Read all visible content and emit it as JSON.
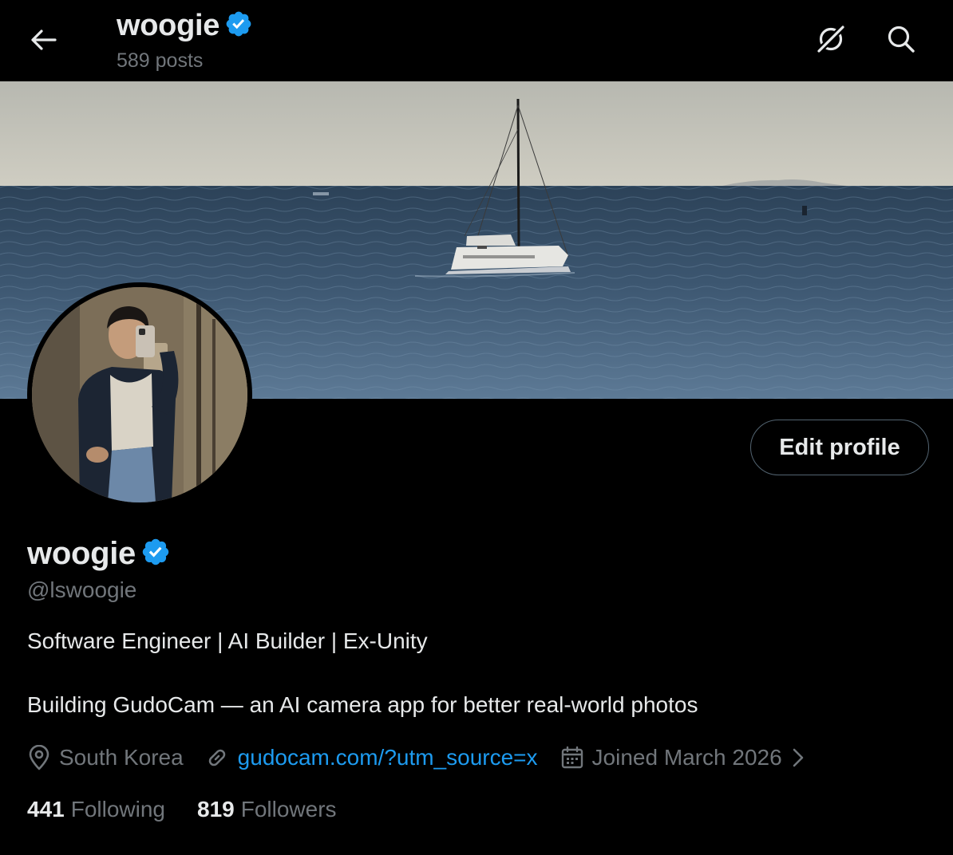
{
  "header": {
    "name": "woogie",
    "posts_count": "589 posts",
    "back_icon": "arrow-left-icon",
    "grok_icon": "grok-icon",
    "search_icon": "search-icon"
  },
  "profile": {
    "display_name": "woogie",
    "verified": true,
    "handle": "@lswoogie",
    "bio_line_1": "Software Engineer | AI Builder | Ex-Unity",
    "bio_line_2": "Building GudoCam — an AI camera app for better real-world photos",
    "location": "South Korea",
    "website": "gudocam.com/?utm_source=x",
    "joined": "Joined March 2026",
    "edit_button": "Edit profile"
  },
  "stats": {
    "following_count": "441",
    "following_label": "Following",
    "followers_count": "819",
    "followers_label": "Followers"
  },
  "colors": {
    "background": "#000000",
    "text_primary": "#e7e9ea",
    "text_secondary": "#71767b",
    "link": "#1d9bf0",
    "verified_badge": "#1d9bf0",
    "border": "#536471"
  }
}
